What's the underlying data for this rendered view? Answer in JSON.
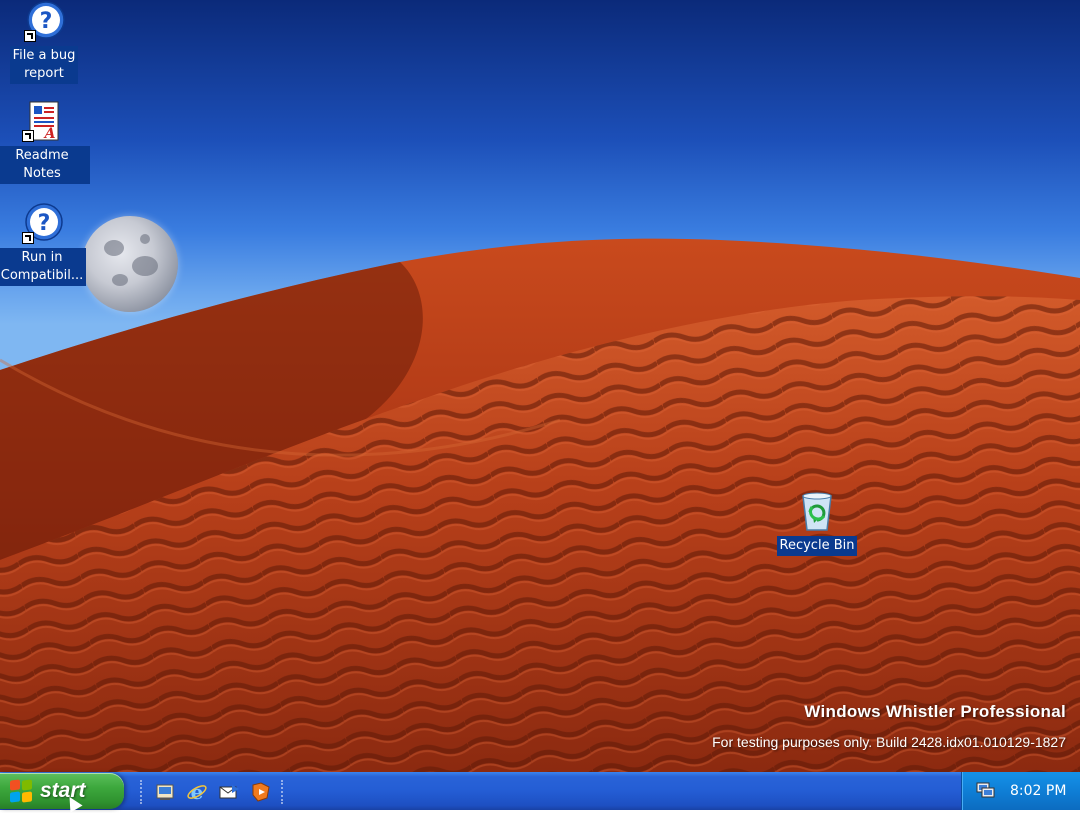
{
  "desktop": {
    "icons": [
      {
        "label_line1": "File a bug",
        "label_line2": "report",
        "icon": "help-shortcut-icon"
      },
      {
        "label_line1": "Readme Notes",
        "label_line2": "",
        "icon": "document-shortcut-icon"
      },
      {
        "label_line1": "Run in",
        "label_line2": "Compatibil...",
        "icon": "help-shortcut-icon"
      },
      {
        "label_line1": "Recycle Bin",
        "label_line2": "",
        "icon": "recycle-bin-icon"
      }
    ],
    "branding": {
      "product": "Windows Whistler Professional",
      "build_text": "For testing purposes only. Build 2428.idx01.010129-1827"
    }
  },
  "taskbar": {
    "start_label": "start",
    "quick_launch": [
      "show-desktop-icon",
      "internet-explorer-icon",
      "outlook-express-icon",
      "windows-media-player-icon"
    ],
    "tray_icon": "network-icon",
    "clock": "8:02 PM"
  },
  "colors": {
    "taskbar_blue": "#245dd4",
    "start_green": "#3da83d",
    "tray_blue": "#0f7fd6",
    "dune_red": "#b8401a"
  }
}
